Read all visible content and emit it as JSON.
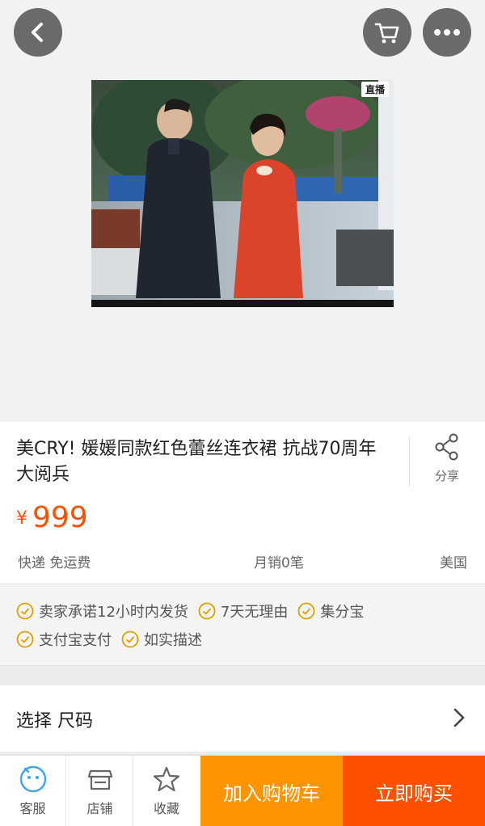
{
  "hero": {
    "badge": "直播",
    "back_icon": "chevron-left-icon",
    "cart_icon": "cart-icon",
    "more_icon": "more-dots-icon"
  },
  "product": {
    "title": "美CRY! 媛媛同款红色蕾丝连衣裙 抗战70周年大阅兵",
    "share_label": "分享",
    "currency": "¥",
    "price": "999",
    "shipping": "快递 免运费",
    "monthly_sales": "月销0笔",
    "origin": "美国"
  },
  "promises": [
    "卖家承诺12小时内发货",
    "7天无理由",
    "集分宝",
    "支付宝支付",
    "如实描述"
  ],
  "size_selector": {
    "label": "选择 尺码"
  },
  "bottom_bar": {
    "service_label": "客服",
    "shop_label": "店铺",
    "favorite_label": "收藏",
    "add_to_cart_label": "加入购物车",
    "buy_now_label": "立即购买"
  },
  "colors": {
    "price": "#ff5000",
    "add_to_cart": "#ff9402",
    "buy_now": "#ff5000",
    "promise_icon": "#e0a000"
  }
}
